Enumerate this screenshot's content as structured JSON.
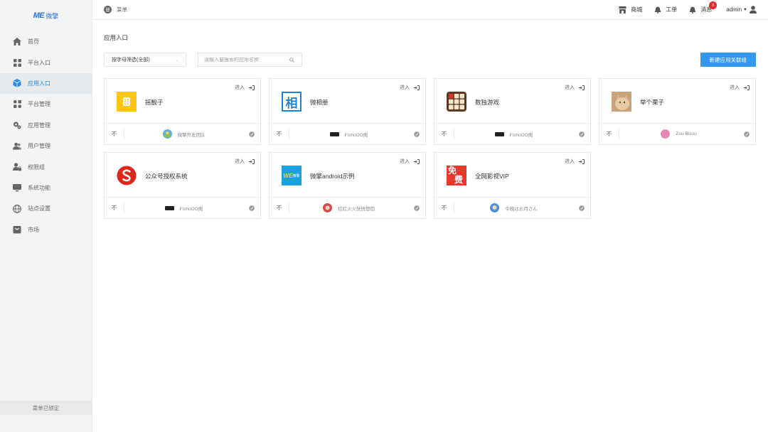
{
  "logo": {
    "mark": "ME",
    "text": "微擎"
  },
  "sidebar": {
    "items": [
      {
        "label": "首页",
        "icon": "home-icon",
        "active": false
      },
      {
        "label": "平台入口",
        "icon": "grid-icon",
        "active": false
      },
      {
        "label": "应用入口",
        "icon": "cube-icon",
        "active": true
      },
      {
        "label": "平台管理",
        "icon": "grid-icon",
        "active": false
      },
      {
        "label": "应用管理",
        "icon": "gears-icon",
        "active": false
      },
      {
        "label": "用户管理",
        "icon": "users-icon",
        "active": false
      },
      {
        "label": "权限组",
        "icon": "user-lock-icon",
        "active": false
      },
      {
        "label": "系统功能",
        "icon": "monitor-icon",
        "active": false
      },
      {
        "label": "站点设置",
        "icon": "globe-icon",
        "active": false
      },
      {
        "label": "市场",
        "icon": "shop-bag-icon",
        "active": false
      }
    ],
    "lock_label": "菜单已锁定"
  },
  "topbar": {
    "menu_label": "菜单",
    "shop_label": "商城",
    "ticket_label": "工单",
    "message_label": "消息",
    "message_count": "8",
    "user_label": "admin"
  },
  "main": {
    "title": "应用入口",
    "filter_selected": "按字母筛选(全部)",
    "search_placeholder": "请输入要搜索的应用名称",
    "new_button": "新建应用关联组",
    "enter_label": "进入",
    "pin_glyph": "不"
  },
  "apps": [
    {
      "name": "摇骰子",
      "icon": "dice-app-icon",
      "owner": "微擎开发团队",
      "avatar": "globe-avatar-icon"
    },
    {
      "name": "微相册",
      "icon": "photo-album-app-icon",
      "owner": "FishoOO阁",
      "avatar": "dark-logo-avatar-icon"
    },
    {
      "name": "数独游戏",
      "icon": "sudoku-app-icon",
      "owner": "FishoOO阁",
      "avatar": "dark-logo-avatar-icon"
    },
    {
      "name": "举个栗子",
      "icon": "cat-photo-app-icon",
      "owner": "Zou Bisou",
      "avatar": "pink-avatar-icon"
    },
    {
      "name": "公众号授权系统",
      "icon": "red-s-app-icon",
      "owner": "FishoOO阁",
      "avatar": "dark-logo-avatar-icon"
    },
    {
      "name": "微擎android示例",
      "icon": "we-android-app-icon",
      "owner": "红红火火恍恍惚惚",
      "avatar": "red-avatar-icon"
    },
    {
      "name": "全网影视VIP",
      "icon": "free-vip-app-icon",
      "owner": "今晚はお月さん",
      "avatar": "blue-avatar-icon"
    }
  ],
  "app_icon_texts": {
    "photo": "相",
    "we": "WE",
    "we_sub": "微擎",
    "free_top": "免",
    "free_bottom": "费"
  },
  "colors": {
    "accent": "#3399ee",
    "active_nav": "#2f8bd6",
    "badge": "#e8262d"
  }
}
